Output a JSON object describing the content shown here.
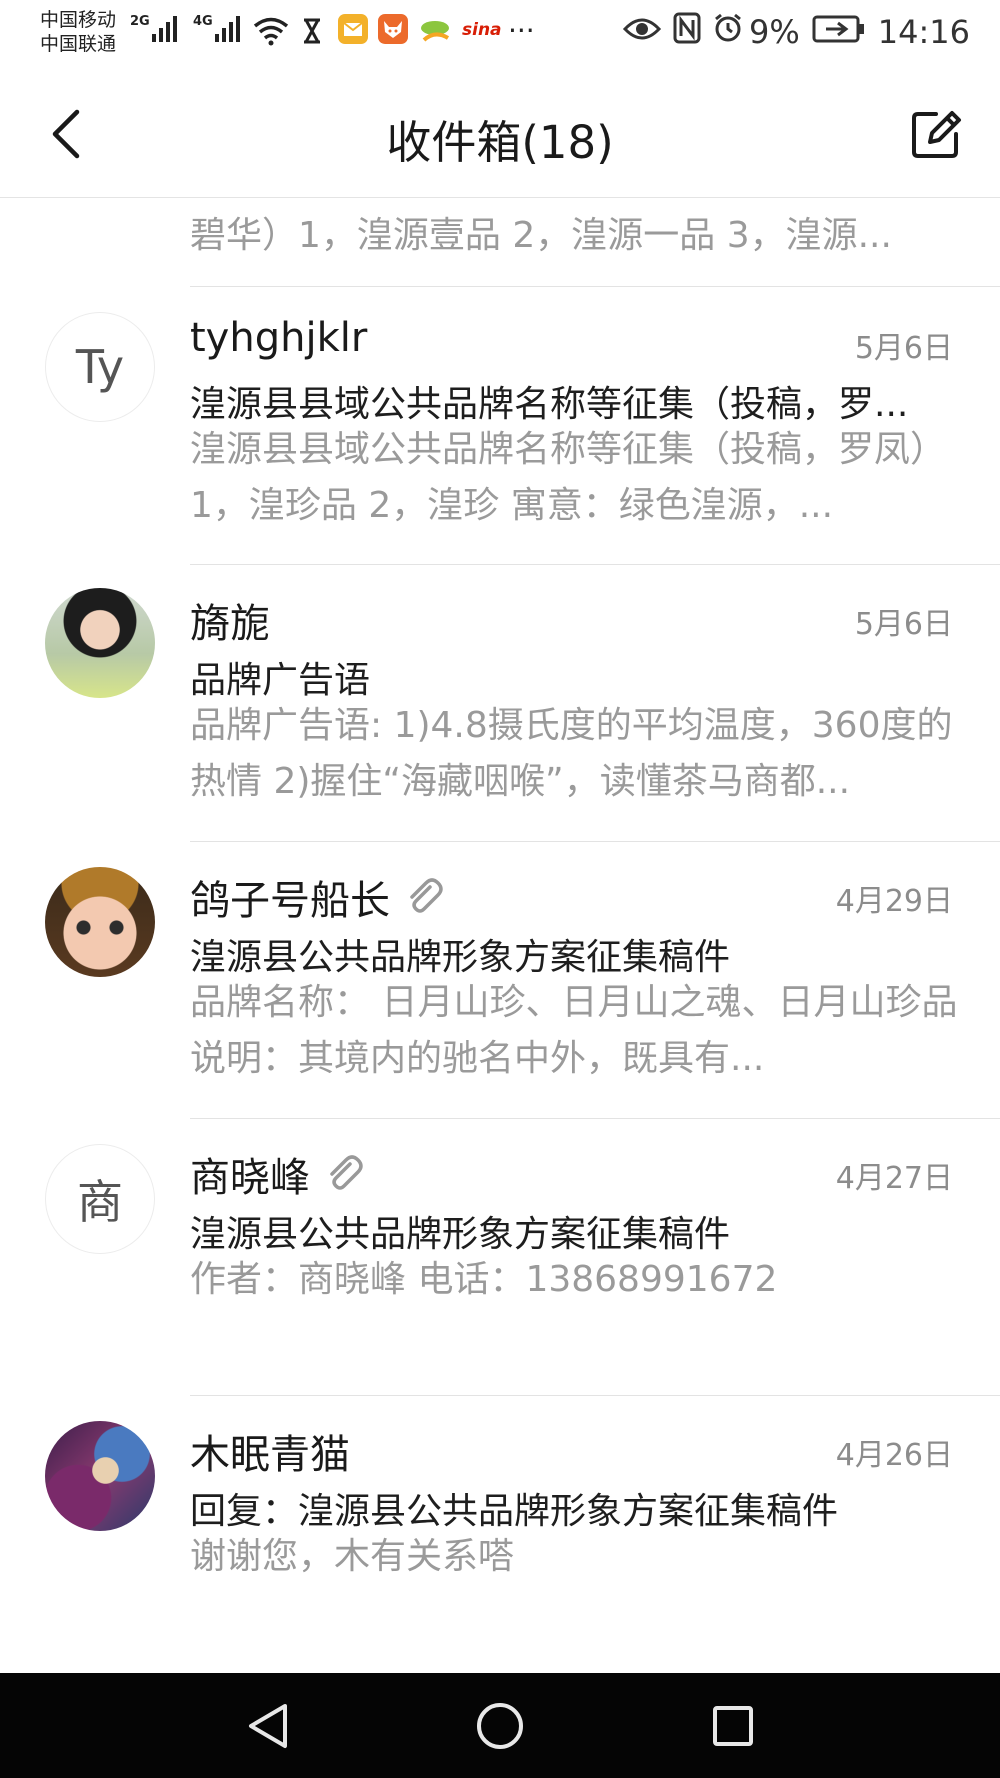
{
  "status_bar": {
    "carrier_1": "中国移动",
    "carrier_2": "中国联通",
    "network_1": "2G",
    "network_2": "4G",
    "battery": "9%",
    "time": "14:16",
    "more": "···",
    "sina_label": "sina"
  },
  "header": {
    "title": "收件箱(18)"
  },
  "mail_list": {
    "partial_top_preview": "碧华）1，湟源壹品 2，湟源一品 3，湟源...",
    "items": [
      {
        "avatar_initial": "Ty",
        "sender": "tyhghjklr",
        "date": "5月6日",
        "subject": "湟源县县域公共品牌名称等征集（投稿，罗...",
        "preview": "湟源县县域公共品牌名称等征集（投稿，罗凤）1，湟珍品 2，湟珍 寓意：绿色湟源，...",
        "has_attachment": false
      },
      {
        "avatar_initial": "",
        "sender": "旖旎",
        "date": "5月6日",
        "subject": "品牌广告语",
        "preview": "品牌广告语: 1)4.8摄氏度的平均温度，360度的热情 2)握住“海藏咽喉”，读懂茶马商都...",
        "has_attachment": false
      },
      {
        "avatar_initial": "",
        "sender": "鸽子号船长",
        "date": "4月29日",
        "subject": "湟源县公共品牌形象方案征集稿件",
        "preview": "品牌名称： 日月山珍、日月山之魂、日月山珍品 说明：其境内的驰名中外，既具有...",
        "has_attachment": true
      },
      {
        "avatar_initial": "商",
        "sender": "商晓峰",
        "date": "4月27日",
        "subject": "湟源县公共品牌形象方案征集稿件",
        "preview": "作者：商晓峰 电话：13868991672",
        "has_attachment": true
      },
      {
        "avatar_initial": "",
        "sender": "木眠青猫",
        "date": "4月26日",
        "subject": "回复：湟源县公共品牌形象方案征集稿件",
        "preview": "谢谢您，木有关系嗒",
        "has_attachment": false
      }
    ]
  },
  "nav_bar": {
    "icons": [
      "back-triangle-icon",
      "home-circle-icon",
      "recents-square-icon"
    ]
  },
  "colors": {
    "primary_text": "#1a1a1a",
    "secondary_text": "#9a9a9a",
    "date_text": "#8c8c8c",
    "nav_background": "#050505"
  }
}
